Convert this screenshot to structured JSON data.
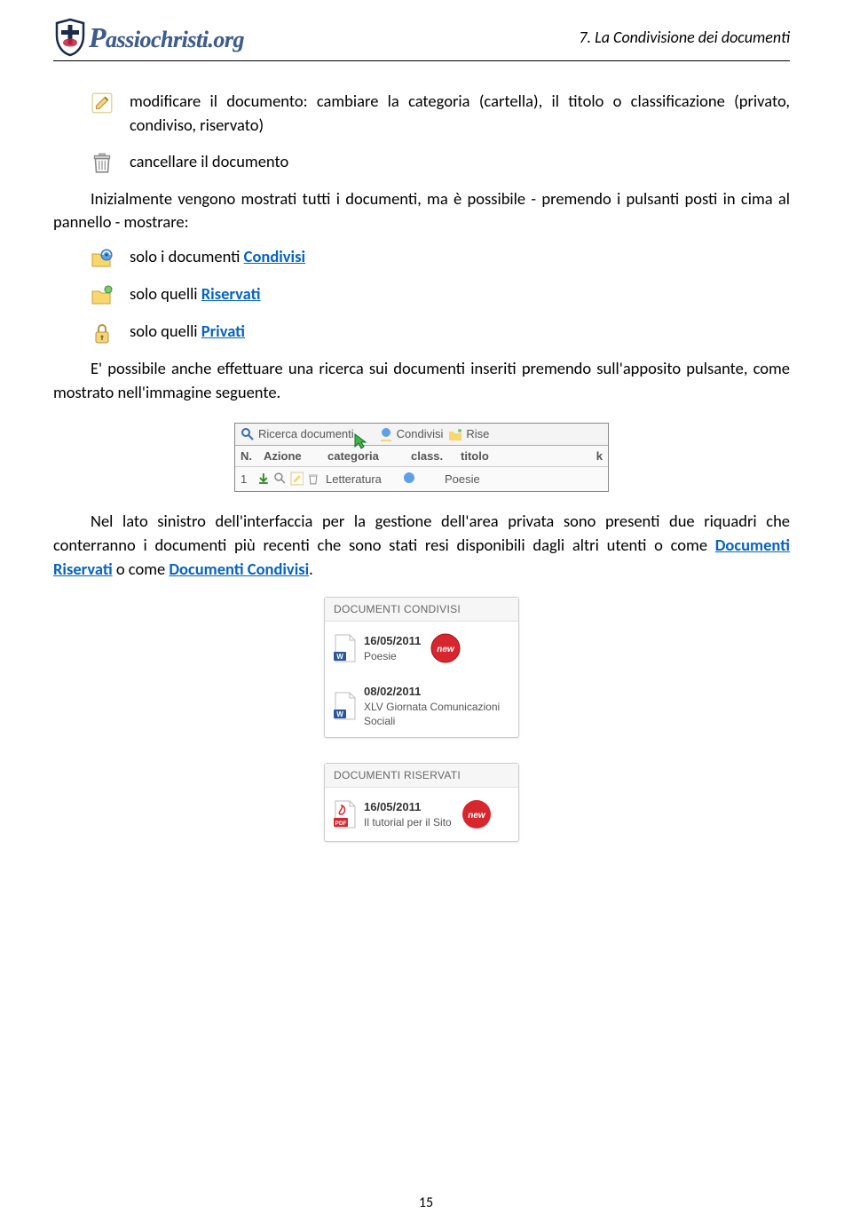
{
  "header": {
    "logo_text": "assiochristi.org",
    "right": "7. La Condivisione dei documenti"
  },
  "bullets1": {
    "edit": "modificare il documento: cambiare la categoria (cartella), il titolo o classificazione (privato, condiviso, riservato)",
    "trash": "cancellare il documento"
  },
  "para_intro": "Inizialmente vengono mostrati tutti i documenti, ma è possibile - premendo i pulsanti posti in cima al pannello - mostrare:",
  "bullets2": {
    "shared_pre": "solo i documenti ",
    "shared_link": "Condivisi",
    "reserved_pre": "solo quelli ",
    "reserved_link": "Riservati",
    "private_pre": "solo quelli ",
    "private_link": "Privati"
  },
  "para_search": "E' possibile anche effettuare una ricerca sui documenti inseriti premendo sull'apposito pulsante, come mostrato nell'immagine seguente.",
  "screenshot1": {
    "search": "Ricerca documenti",
    "condivisi": "Condivisi",
    "rise": "Rise",
    "col_n": "N.",
    "col_azione": "Azione",
    "col_categoria": "categoria",
    "col_class": "class.",
    "col_titolo": "titolo",
    "col_k": "k",
    "row_n": "1",
    "row_cat": "Letteratura",
    "row_title": "Poesie"
  },
  "para_left_pre": "Nel lato sinistro dell'interfaccia per la gestione dell'area privata sono presenti due riquadri che conterranno i documenti più recenti che sono stati resi disponibili dagli altri utenti o come ",
  "para_left_link1": "Documenti Riservati",
  "para_left_mid": " o come ",
  "para_left_link2": "Documenti Condivisi",
  "para_left_end": ".",
  "panels": {
    "condivisi_title": "DOCUMENTI CONDIVISI",
    "riservati_title": "DOCUMENTI RISERVATI",
    "item1_date": "16/05/2011",
    "item1_title": "Poesie",
    "item2_date": "08/02/2011",
    "item2_title": "XLV Giornata Comunicazioni Sociali",
    "item3_date": "16/05/2011",
    "item3_title": "Il tutorial per il Sito"
  },
  "new_label": "new",
  "page_number": "15"
}
